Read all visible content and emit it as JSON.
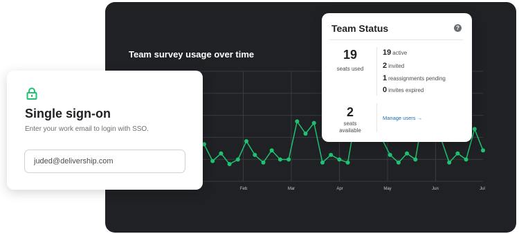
{
  "chart": {
    "title": "Team survey usage over time",
    "accent_color": "#1fc271",
    "grid_color": "#3a3d40"
  },
  "chart_data": {
    "type": "line",
    "title": "Team survey usage over time",
    "xlabel": "",
    "ylabel": "",
    "categories": [
      "Feb",
      "Mar",
      "Apr",
      "May",
      "Jun",
      "Jul"
    ],
    "x": [
      1,
      2,
      3,
      4,
      5,
      6,
      7,
      8,
      9,
      10,
      11,
      12,
      13,
      14,
      15,
      16,
      17,
      18,
      19,
      20,
      21,
      22,
      23,
      24,
      25,
      26,
      27,
      28,
      29,
      30,
      31,
      32,
      33,
      34
    ],
    "values": [
      18,
      7,
      12,
      5,
      8,
      20,
      11,
      6,
      14,
      8,
      8,
      33,
      25,
      32,
      6,
      11,
      8,
      6,
      38,
      30,
      27,
      22,
      11,
      6,
      12,
      8,
      40,
      32,
      22,
      6,
      12,
      8,
      28,
      14
    ],
    "ylim": [
      0,
      40
    ],
    "grid": true,
    "legend": "none"
  },
  "sso": {
    "title": "Single sign-on",
    "subtitle": "Enter your work email to login with SSO.",
    "email_value": "juded@delivership.com",
    "lock_icon": "lock-icon",
    "accent_color": "#1fc271"
  },
  "status": {
    "title": "Team Status",
    "help_icon": "question-icon",
    "seats_used_value": "19",
    "seats_used_label": "seats used",
    "seats_available_value": "2",
    "seats_available_label_1": "seats",
    "seats_available_label_2": "available",
    "active_value": "19",
    "active_label": "active",
    "invited_value": "2",
    "invited_label": "invited",
    "reassign_value": "1",
    "reassign_label": "reassignments pending",
    "expired_value": "0",
    "expired_label": "invites expired",
    "manage_label": "Manage users →"
  }
}
